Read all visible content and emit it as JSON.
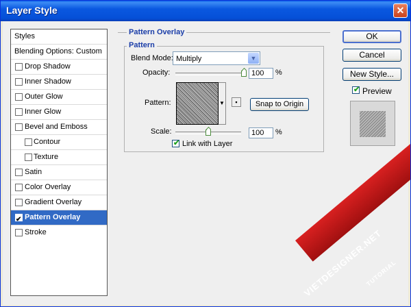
{
  "window": {
    "title": "Layer Style",
    "close_glyph": "✕"
  },
  "style_list": {
    "items": [
      {
        "label": "Styles",
        "checked": null
      },
      {
        "label": "Blending Options: Custom",
        "checked": null
      },
      {
        "label": "Drop Shadow",
        "checked": false
      },
      {
        "label": "Inner Shadow",
        "checked": false
      },
      {
        "label": "Outer Glow",
        "checked": false
      },
      {
        "label": "Inner Glow",
        "checked": false
      },
      {
        "label": "Bevel and Emboss",
        "checked": false
      },
      {
        "label": "Contour",
        "checked": false
      },
      {
        "label": "Texture",
        "checked": false
      },
      {
        "label": "Satin",
        "checked": false
      },
      {
        "label": "Color Overlay",
        "checked": false
      },
      {
        "label": "Gradient Overlay",
        "checked": false
      },
      {
        "label": "Pattern Overlay",
        "checked": true,
        "selected": true
      },
      {
        "label": "Stroke",
        "checked": false
      }
    ]
  },
  "pattern_overlay": {
    "title": "Pattern Overlay",
    "pattern_group": "Pattern",
    "blend_mode_label": "Blend Mode:",
    "blend_mode_value": "Multiply",
    "opacity_label": "Opacity:",
    "opacity_value": "100",
    "opacity_unit": "%",
    "opacity_level": 1.0,
    "pattern_label": "Pattern:",
    "snap_button": "Snap to Origin",
    "scale_label": "Scale:",
    "scale_value": "100",
    "scale_unit": "%",
    "scale_level": 0.5,
    "link_label": "Link with Layer",
    "link_checked": true
  },
  "actions": {
    "ok": "OK",
    "cancel": "Cancel",
    "new_style": "New Style...",
    "preview_label": "Preview",
    "preview_checked": true
  },
  "watermark": {
    "text": "VIETDESIGNER.NET",
    "sub": "TUTORIAL"
  },
  "colors": {
    "accent": "#316ac5",
    "title_bar": "#0a58e0",
    "legend": "#1a3da8",
    "watermark": "#c81818"
  }
}
